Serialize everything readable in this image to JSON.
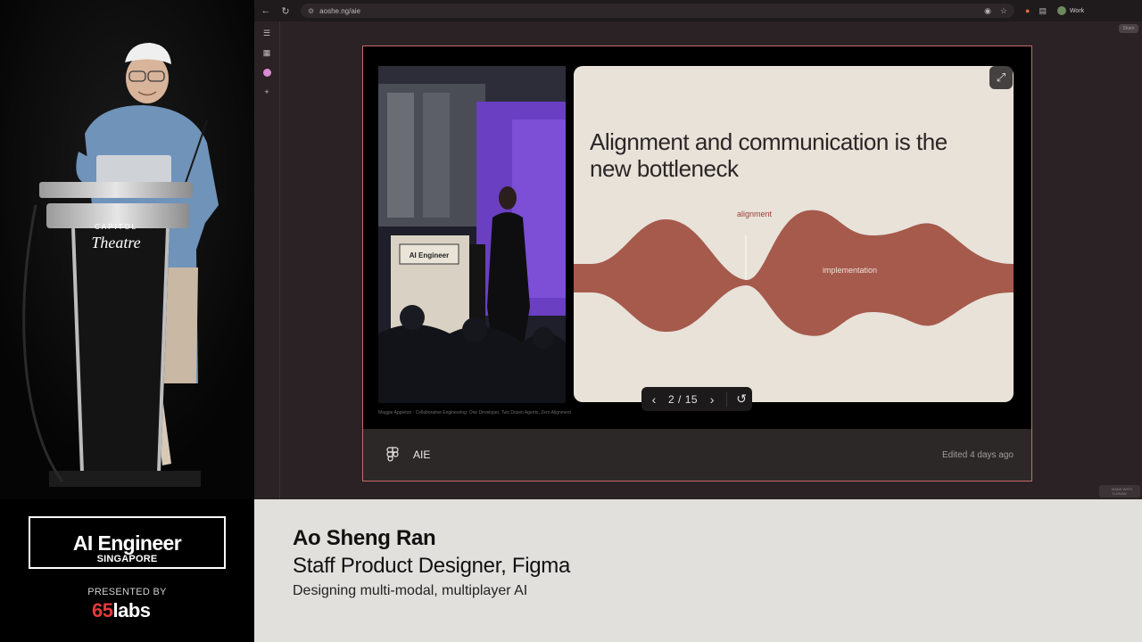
{
  "browser": {
    "url": "aoshe.ng/aie",
    "profile_label": "Work",
    "mini_badge": "Share",
    "tldraw_badge": "MADE WITH TLDRAW"
  },
  "slide": {
    "title": "Alignment and communication is the new bottleneck",
    "label_alignment": "alignment",
    "label_implementation": "implementation",
    "caption": "Maggie Appleton · Collaborative Engineering: One Developer, Two Dozen Agents, Zero Alignment",
    "photo_sign": "AI Engineer",
    "counter": "2 / 15"
  },
  "embed_footer": {
    "title": "AIE",
    "edited": "Edited 4 days ago"
  },
  "camera": {
    "podium_line1": "CAPITOL",
    "podium_line2": "Theatre"
  },
  "lower_third": {
    "event_name": "AI Engineer",
    "event_location": "SINGAPORE",
    "presented_by": "PRESENTED BY",
    "sponsor_num": "65",
    "sponsor_word": "labs",
    "speaker_name": "Ao Sheng Ran",
    "speaker_role": "Staff Product Designer, Figma",
    "talk_title": "Designing multi-modal, multiplayer AI"
  },
  "colors": {
    "wave": "#a65a4c",
    "slide_bg": "#e8e2d9",
    "embed_border": "#c96a6a",
    "lower_third_bg": "#e2e0dc",
    "sponsor_red": "#e23a3a"
  },
  "icons": [
    "back-icon",
    "reload-icon",
    "site-info-icon",
    "eye-off-icon",
    "star-icon",
    "extensions-icon",
    "sidebar-toggle-icon",
    "grid-icon",
    "add-icon",
    "expand-icon",
    "chevron-left-icon",
    "chevron-right-icon",
    "reset-icon",
    "figma-icon"
  ]
}
